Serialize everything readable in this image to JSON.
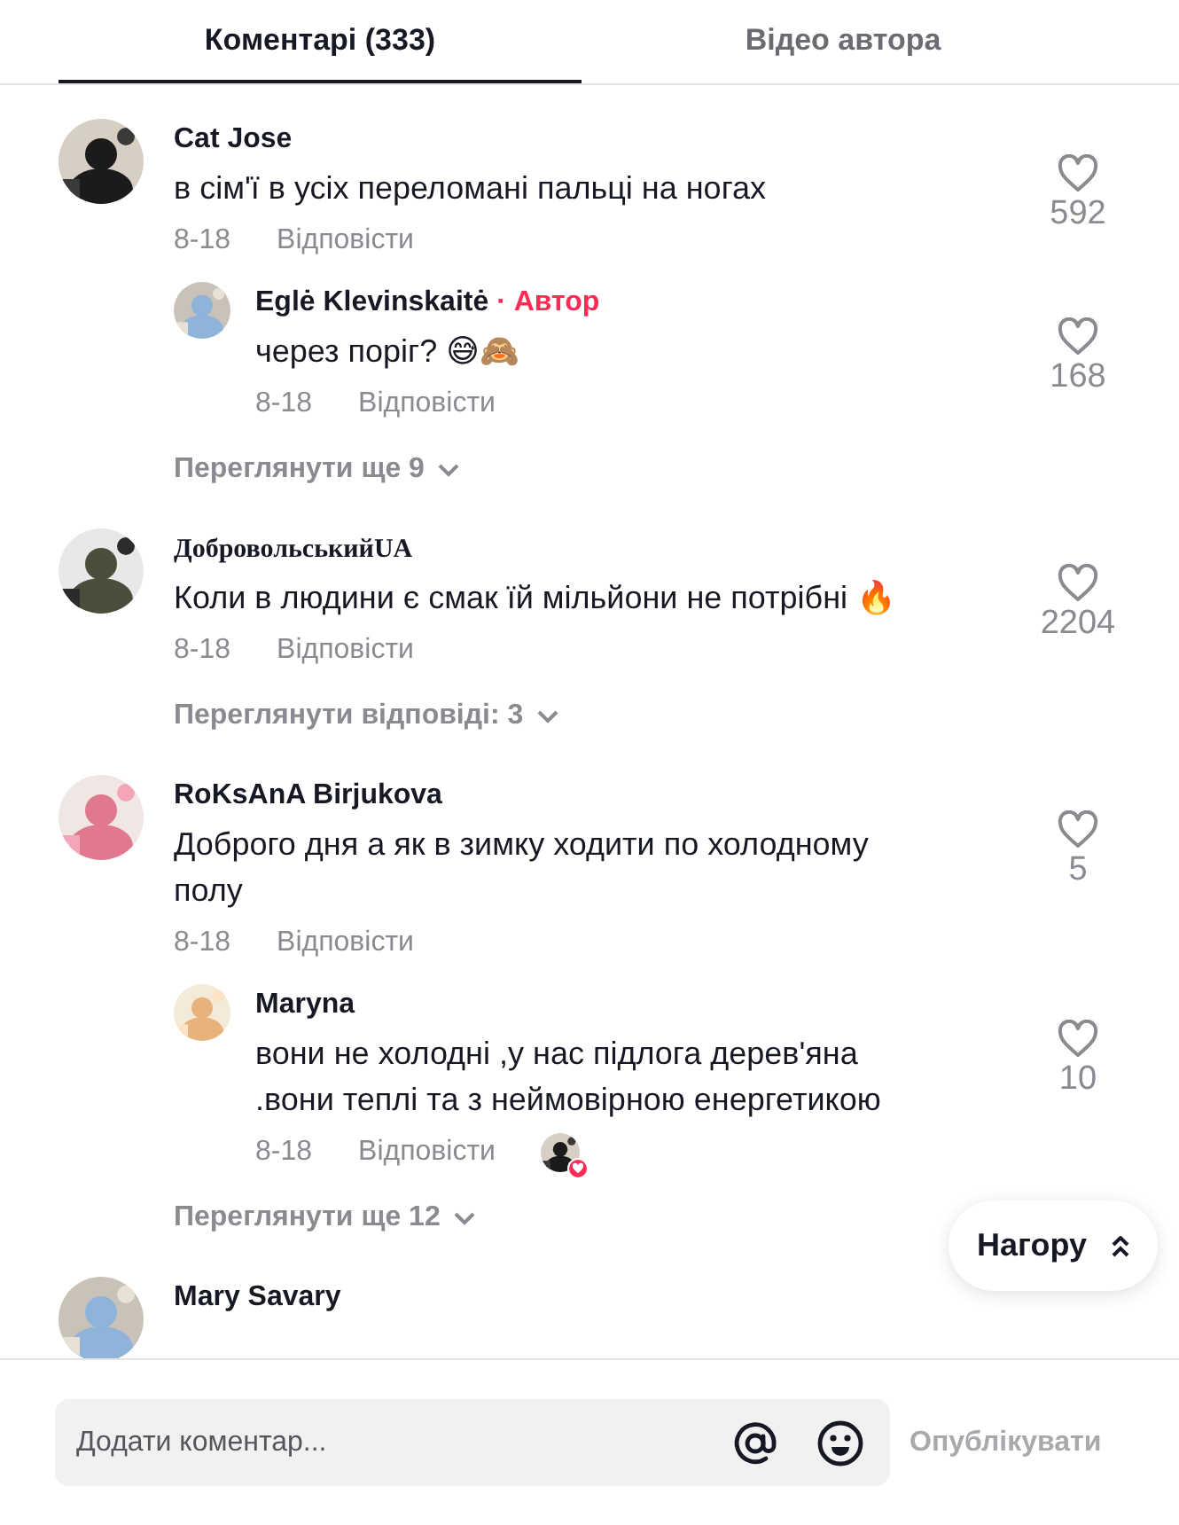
{
  "tabs": [
    {
      "label": "Коментарі (333)",
      "selected": true
    },
    {
      "label": "Відео автора",
      "selected": false
    }
  ],
  "comments": [
    {
      "author": "Cat Jose",
      "kind": "plain",
      "avatar": {
        "kind": "picture"
      },
      "text": "в сім'ї в усіх переломані пальці на ногах",
      "date": "8-18",
      "reply_label": "Відповісти",
      "likes": "592",
      "replies": [
        {
          "author": "Eglė Klevinskaitė",
          "badge": "· Автор",
          "avatar": {
            "kind": "picture"
          },
          "text": "через поріг? 😅🙈",
          "date": "8-18",
          "reply_label": "Відповісти",
          "likes": "168",
          "liked_by_author": false
        }
      ],
      "more_label": "Переглянути ще 9"
    },
    {
      "author": "ДобровольськийUA",
      "kind": "fancy_name",
      "avatar": {
        "kind": "picture"
      },
      "text": "Коли в людини є смак їй мільйони не потрібні 🔥",
      "date": "8-18",
      "reply_label": "Відповісти",
      "likes": "2204",
      "more_label": "Переглянути відповіді: 3"
    },
    {
      "author": "RoKsAnA Birjukova",
      "kind": "plain",
      "avatar": {
        "kind": "picture"
      },
      "text": "Доброго дня а як в зимку ходити по холодному полу",
      "date": "8-18",
      "reply_label": "Відповісти",
      "likes": "5",
      "replies": [
        {
          "author": "Maryna",
          "avatar": {
            "kind": "picture"
          },
          "text": "вони не холодні ,у нас підлога дерев'яна .вони теплі та з неймовірною енергетикою",
          "date": "8-18",
          "reply_label": "Відповісти",
          "likes": "10",
          "liked_by_author": true
        }
      ],
      "more_label": "Переглянути ще 12"
    },
    {
      "author": "Mary Savary",
      "kind": "plain",
      "avatar": {
        "kind": "picture"
      }
    }
  ],
  "back_to_top": "Нагору",
  "composer": {
    "placeholder": "Додати коментар...",
    "submit": "Опублікувати"
  }
}
